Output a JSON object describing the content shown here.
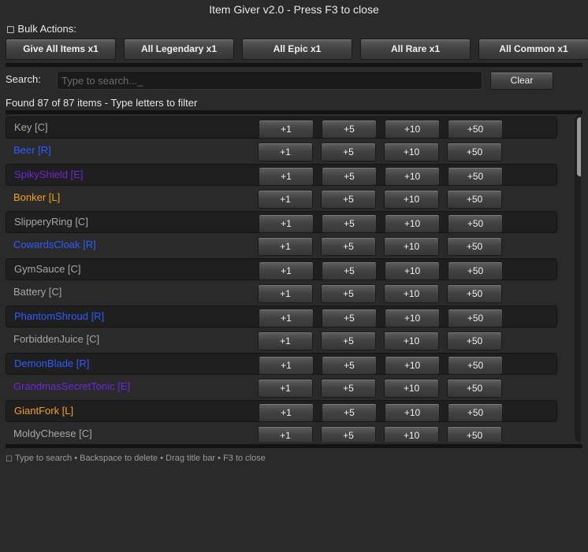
{
  "window": {
    "title": "Item Giver v2.0 - Press F3 to close"
  },
  "bulk": {
    "label": "◻ Bulk Actions:",
    "buttons": [
      "Give All Items x1",
      "All Legendary x1",
      "All Epic x1",
      "All Rare x1",
      "All Common x1"
    ]
  },
  "search": {
    "label": "Search:",
    "placeholder": "Type to search..._",
    "value": "",
    "clear_label": "Clear"
  },
  "status": {
    "found_text": "Found 87 of 87 items - Type letters to filter"
  },
  "colors": {
    "common": "#a6a6a6",
    "rare": "#2f5bff",
    "epic": "#6f26d8",
    "legendary": "#f2a01c"
  },
  "quantity_labels": [
    "+1",
    "+5",
    "+10",
    "+50"
  ],
  "items": [
    {
      "name": "Key [C]",
      "rarity": "common"
    },
    {
      "name": "Beer [R]",
      "rarity": "rare"
    },
    {
      "name": "SpikyShield [E]",
      "rarity": "epic"
    },
    {
      "name": "Bonker [L]",
      "rarity": "legendary"
    },
    {
      "name": "SlipperyRing [C]",
      "rarity": "common"
    },
    {
      "name": "CowardsCloak [R]",
      "rarity": "rare"
    },
    {
      "name": "GymSauce [C]",
      "rarity": "common"
    },
    {
      "name": "Battery [C]",
      "rarity": "common"
    },
    {
      "name": "PhantomShroud [R]",
      "rarity": "rare"
    },
    {
      "name": "ForbiddenJuice [C]",
      "rarity": "common"
    },
    {
      "name": "DemonBlade [R]",
      "rarity": "rare"
    },
    {
      "name": "GrandmasSecretTonic [E]",
      "rarity": "epic"
    },
    {
      "name": "GiantFork [L]",
      "rarity": "legendary"
    },
    {
      "name": "MoldyCheese [C]",
      "rarity": "common"
    }
  ],
  "footer": {
    "text": "◻ Type to search • Backspace to delete • Drag title bar • F3 to close"
  }
}
